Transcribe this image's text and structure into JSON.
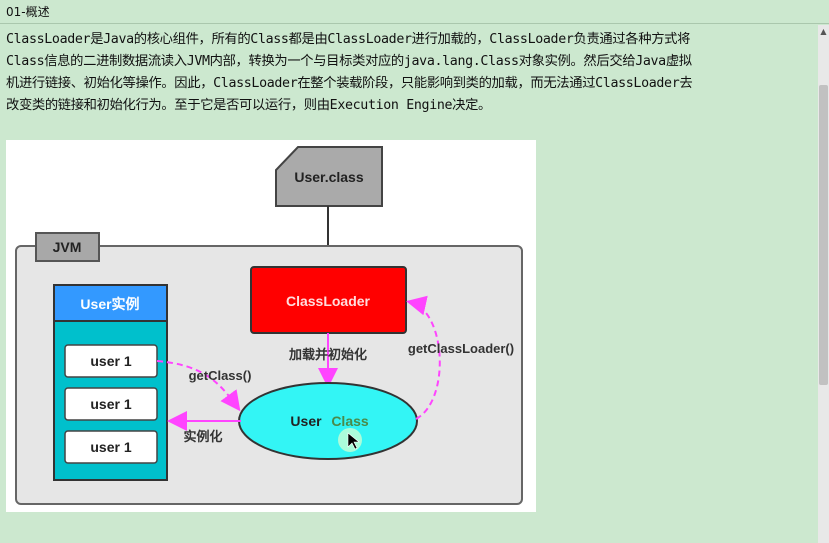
{
  "window": {
    "title": "01-概述"
  },
  "paragraph": {
    "lines": [
      "ClassLoader是Java的核心组件，所有的Class都是由ClassLoader进行加载的，ClassLoader负责通过各种方式将",
      "Class信息的二进制数据流读入JVM内部，转换为一个与目标类对应的java.lang.Class对象实例。然后交给Java虚拟",
      "机进行链接、初始化等操作。因此，ClassLoader在整个装载阶段，只能影响到类的加载，而无法通过ClassLoader去",
      "改变类的链接和初始化行为。至于它是否可以运行，则由Execution Engine决定。"
    ]
  },
  "diagram": {
    "file_label": "User.class",
    "jvm_label": "JVM",
    "instances_header": "User实例",
    "instances": [
      "user 1",
      "user 1",
      "user 1"
    ],
    "classloader_label": "ClassLoader",
    "load_init_label": "加载并初始化",
    "get_classloader_label": "getClassLoader()",
    "get_class_label": "getClass()",
    "instantiate_label": "实例化",
    "user_class_label_user": "User",
    "user_class_label_class": "Class",
    "colors": {
      "classloader": "#ff0000",
      "user_class": "#33f5f5",
      "instances_panel": "#00c0cc",
      "instances_header": "#3399ff",
      "arrows": "#ff44ff",
      "jvm_box": "#e6e6e6"
    }
  }
}
